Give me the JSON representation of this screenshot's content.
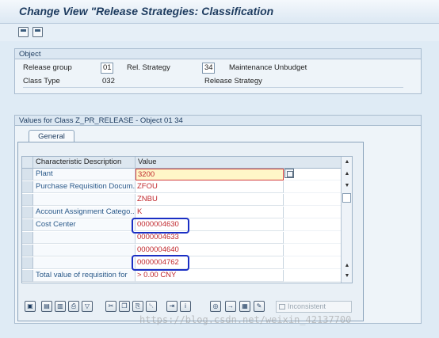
{
  "window": {
    "title": "Change View \"Release Strategies: Classification"
  },
  "toolbar": {
    "icons": [
      "save-icon",
      "save-as-icon"
    ]
  },
  "object_group": {
    "heading": "Object",
    "release_group_label": "Release group",
    "release_group_value": "01",
    "rel_strategy_label": "Rel. Strategy",
    "rel_strategy_value": "34",
    "rel_strategy_text": "Maintenance Unbudget",
    "class_type_label": "Class Type",
    "class_type_value": "032",
    "class_type_text": "Release Strategy"
  },
  "values_group": {
    "heading": "Values for Class Z_PR_RELEASE - Object 01 34",
    "tab_label": "General",
    "columns": [
      "Characteristic Description",
      "Value"
    ],
    "rows": [
      {
        "desc": "Plant",
        "value": "3200"
      },
      {
        "desc": "Purchase Requisition Docum...",
        "value": "ZFOU"
      },
      {
        "desc": "",
        "value": "ZNBU"
      },
      {
        "desc": "Account Assignment Catego...",
        "value": "K"
      },
      {
        "desc": "Cost Center",
        "value": "0000004630"
      },
      {
        "desc": "",
        "value": "0000004633"
      },
      {
        "desc": "",
        "value": "0000004640"
      },
      {
        "desc": "",
        "value": "0000004762"
      },
      {
        "desc": "Total value of requisition for",
        "value": "> 0.00 CNY"
      }
    ],
    "status_text": "Inconsistent"
  },
  "bottom_toolbar": {
    "icons": [
      "details-icon",
      "table-icon",
      "table-select-icon",
      "print-icon",
      "filter-icon",
      "cut-icon",
      "copy-icon",
      "paste-icon",
      "delete-icon",
      "export-icon",
      "info-icon",
      "find-icon",
      "find-next-icon",
      "layout-icon",
      "change-icon"
    ]
  },
  "watermark": "https://blog.csdn.net/weixin_42137700"
}
